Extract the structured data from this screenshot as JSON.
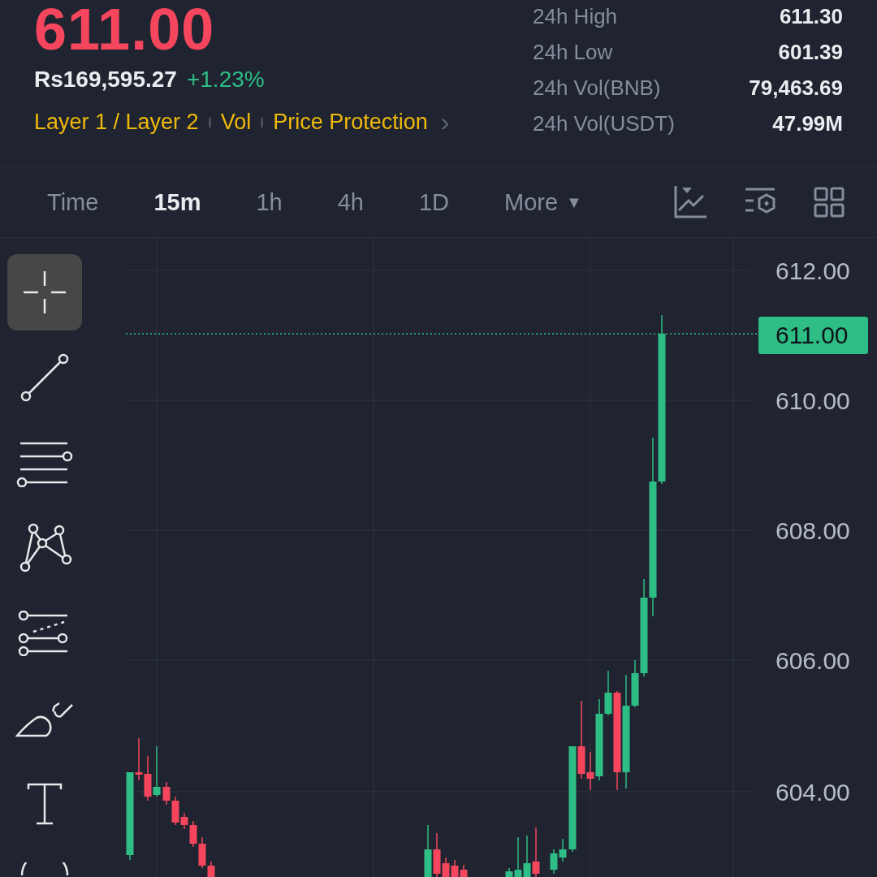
{
  "ticker": {
    "last_price": "611.00",
    "fiat_price": "Rs169,595.27",
    "change": "+1.23%",
    "tags": [
      "Layer 1 / Layer 2",
      "Vol",
      "Price Protection"
    ],
    "tags_more": "›"
  },
  "stats": [
    {
      "label": "24h High",
      "value": "611.30"
    },
    {
      "label": "24h Low",
      "value": "601.39"
    },
    {
      "label": "24h Vol(BNB)",
      "value": "79,463.69"
    },
    {
      "label": "24h Vol(USDT)",
      "value": "47.99M"
    }
  ],
  "intervals": [
    {
      "label": "Time",
      "selected": false
    },
    {
      "label": "15m",
      "selected": true
    },
    {
      "label": "1h",
      "selected": false
    },
    {
      "label": "4h",
      "selected": false
    },
    {
      "label": "1D",
      "selected": false
    }
  ],
  "more_menu": {
    "label": "More",
    "caret": "▼"
  },
  "chart_tools": [
    {
      "kind": "indicator"
    },
    {
      "kind": "settings"
    },
    {
      "kind": "grid"
    }
  ],
  "drawing_tools": [
    {
      "kind": "crosshair",
      "selected": true
    },
    {
      "kind": "trend-line",
      "selected": false
    },
    {
      "kind": "parallel-lines",
      "selected": false
    },
    {
      "kind": "pattern",
      "selected": false
    },
    {
      "kind": "fib",
      "selected": false
    },
    {
      "kind": "brush",
      "selected": false
    },
    {
      "kind": "text",
      "selected": false
    },
    {
      "kind": "shape",
      "selected": false
    }
  ],
  "price_axis": [
    "612.00",
    "610.00",
    "608.00",
    "606.00",
    "604.00"
  ],
  "current_price_tag": "611.00"
}
